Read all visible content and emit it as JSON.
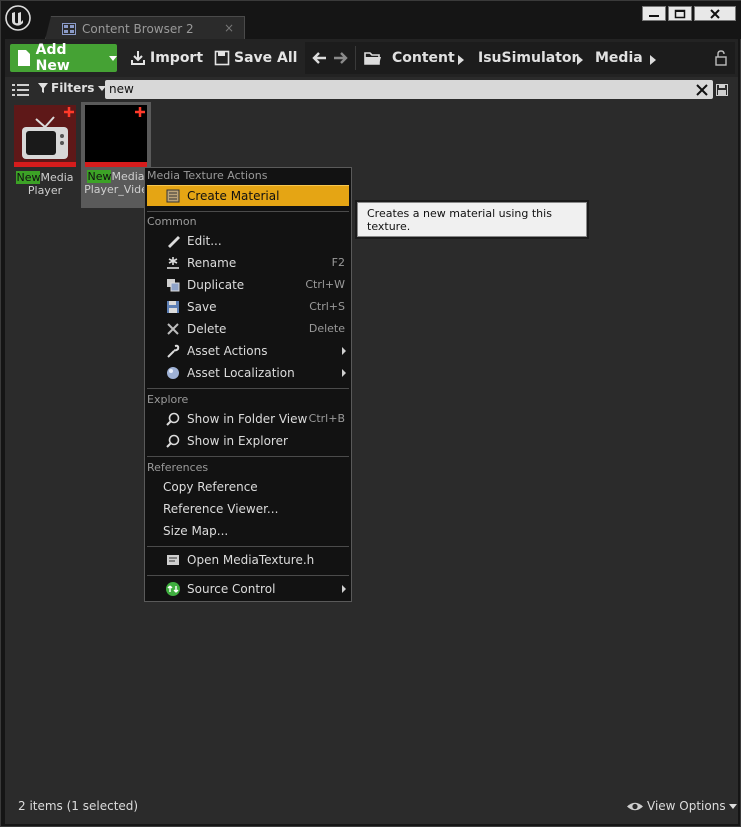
{
  "window": {
    "tab_label": "Content Browser 2",
    "tab_close": "×"
  },
  "toolbar": {
    "add_new": "Add New",
    "import": "Import",
    "save_all": "Save All"
  },
  "breadcrumb": [
    "Content",
    "IsuSimulator",
    "Media"
  ],
  "filters": {
    "label": "Filters",
    "search_value": "new"
  },
  "assets": [
    {
      "highlight": "New",
      "name_rest": "Media",
      "line2": "Player",
      "selected": false
    },
    {
      "highlight": "New",
      "name_rest": "Media",
      "line2": "Player_Vide",
      "selected": true
    }
  ],
  "context_menu": {
    "sections": {
      "media_texture_actions": "Media Texture Actions",
      "common": "Common",
      "explore": "Explore",
      "references": "References"
    },
    "items": {
      "create_material": "Create Material",
      "edit": "Edit...",
      "rename": "Rename",
      "rename_sc": "F2",
      "duplicate": "Duplicate",
      "duplicate_sc": "Ctrl+W",
      "save": "Save",
      "save_sc": "Ctrl+S",
      "delete": "Delete",
      "delete_sc": "Delete",
      "asset_actions": "Asset Actions",
      "asset_localization": "Asset Localization",
      "show_in_folder_view": "Show in Folder View",
      "show_in_folder_view_sc": "Ctrl+B",
      "show_in_explorer": "Show in Explorer",
      "copy_reference": "Copy Reference",
      "reference_viewer": "Reference Viewer...",
      "size_map": "Size Map...",
      "open_header": "Open MediaTexture.h",
      "source_control": "Source Control"
    }
  },
  "tooltip": "Creates a new material using this texture.",
  "status": {
    "count": "2 items (1 selected)",
    "view_options": "View Options"
  },
  "colors": {
    "add_new_green": "#45a234",
    "menu_highlight": "#e5a514",
    "search_highlight": "#3ca226"
  }
}
